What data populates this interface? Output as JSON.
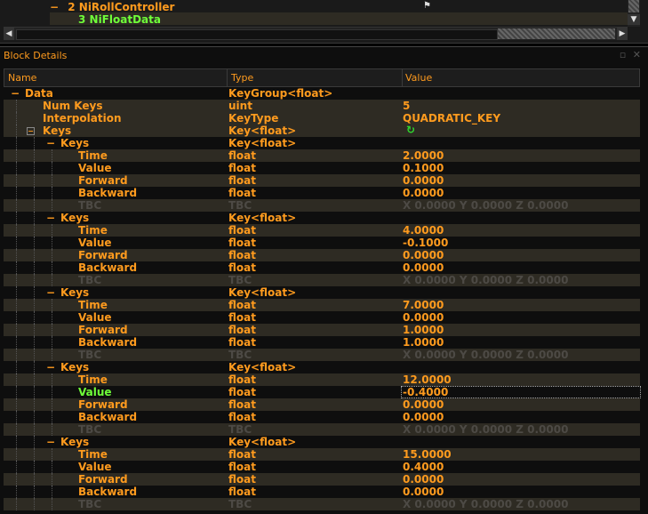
{
  "top_tree": {
    "rows": [
      {
        "label": "2 NiRollController",
        "expander": "−"
      },
      {
        "label": "3 NiFloatData"
      }
    ]
  },
  "panel_title": "Block Details",
  "columns": [
    "Name",
    "Type",
    "Value"
  ],
  "rows": [
    {
      "name": "Data",
      "type": "KeyGroup<float>",
      "value": "",
      "exp": "−"
    },
    {
      "name": "Num Keys",
      "type": "uint",
      "value": "5"
    },
    {
      "name": "Interpolation",
      "type": "KeyType",
      "value": "QUADRATIC_KEY"
    },
    {
      "name": "Keys",
      "type": "Key<float>",
      "value": ""
    },
    {
      "name": "Keys",
      "type": "Key<float>",
      "value": "",
      "exp": "−"
    },
    {
      "name": "Time",
      "type": "float",
      "value": "2.0000"
    },
    {
      "name": "Value",
      "type": "float",
      "value": "0.1000"
    },
    {
      "name": "Forward",
      "type": "float",
      "value": "0.0000"
    },
    {
      "name": "Backward",
      "type": "float",
      "value": "0.0000"
    },
    {
      "name": "TBC",
      "type": "TBC",
      "value": "X 0.0000 Y 0.0000 Z 0.0000"
    },
    {
      "name": "Keys",
      "type": "Key<float>",
      "value": "",
      "exp": "−"
    },
    {
      "name": "Time",
      "type": "float",
      "value": "4.0000"
    },
    {
      "name": "Value",
      "type": "float",
      "value": "-0.1000"
    },
    {
      "name": "Forward",
      "type": "float",
      "value": "0.0000"
    },
    {
      "name": "Backward",
      "type": "float",
      "value": "0.0000"
    },
    {
      "name": "TBC",
      "type": "TBC",
      "value": "X 0.0000 Y 0.0000 Z 0.0000"
    },
    {
      "name": "Keys",
      "type": "Key<float>",
      "value": "",
      "exp": "−"
    },
    {
      "name": "Time",
      "type": "float",
      "value": "7.0000"
    },
    {
      "name": "Value",
      "type": "float",
      "value": "0.0000"
    },
    {
      "name": "Forward",
      "type": "float",
      "value": "1.0000"
    },
    {
      "name": "Backward",
      "type": "float",
      "value": "1.0000"
    },
    {
      "name": "TBC",
      "type": "TBC",
      "value": "X 0.0000 Y 0.0000 Z 0.0000"
    },
    {
      "name": "Keys",
      "type": "Key<float>",
      "value": "",
      "exp": "−"
    },
    {
      "name": "Time",
      "type": "float",
      "value": "12.0000"
    },
    {
      "name": "Value",
      "type": "float",
      "value": "-0.4000"
    },
    {
      "name": "Forward",
      "type": "float",
      "value": "0.0000"
    },
    {
      "name": "Backward",
      "type": "float",
      "value": "0.0000"
    },
    {
      "name": "TBC",
      "type": "TBC",
      "value": "X 0.0000 Y 0.0000 Z 0.0000"
    },
    {
      "name": "Keys",
      "type": "Key<float>",
      "value": "",
      "exp": "−"
    },
    {
      "name": "Time",
      "type": "float",
      "value": "15.0000"
    },
    {
      "name": "Value",
      "type": "float",
      "value": "0.4000"
    },
    {
      "name": "Forward",
      "type": "float",
      "value": "0.0000"
    },
    {
      "name": "Backward",
      "type": "float",
      "value": "0.0000"
    },
    {
      "name": "TBC",
      "type": "TBC",
      "value": "X 0.0000 Y 0.0000 Z 0.0000"
    }
  ]
}
